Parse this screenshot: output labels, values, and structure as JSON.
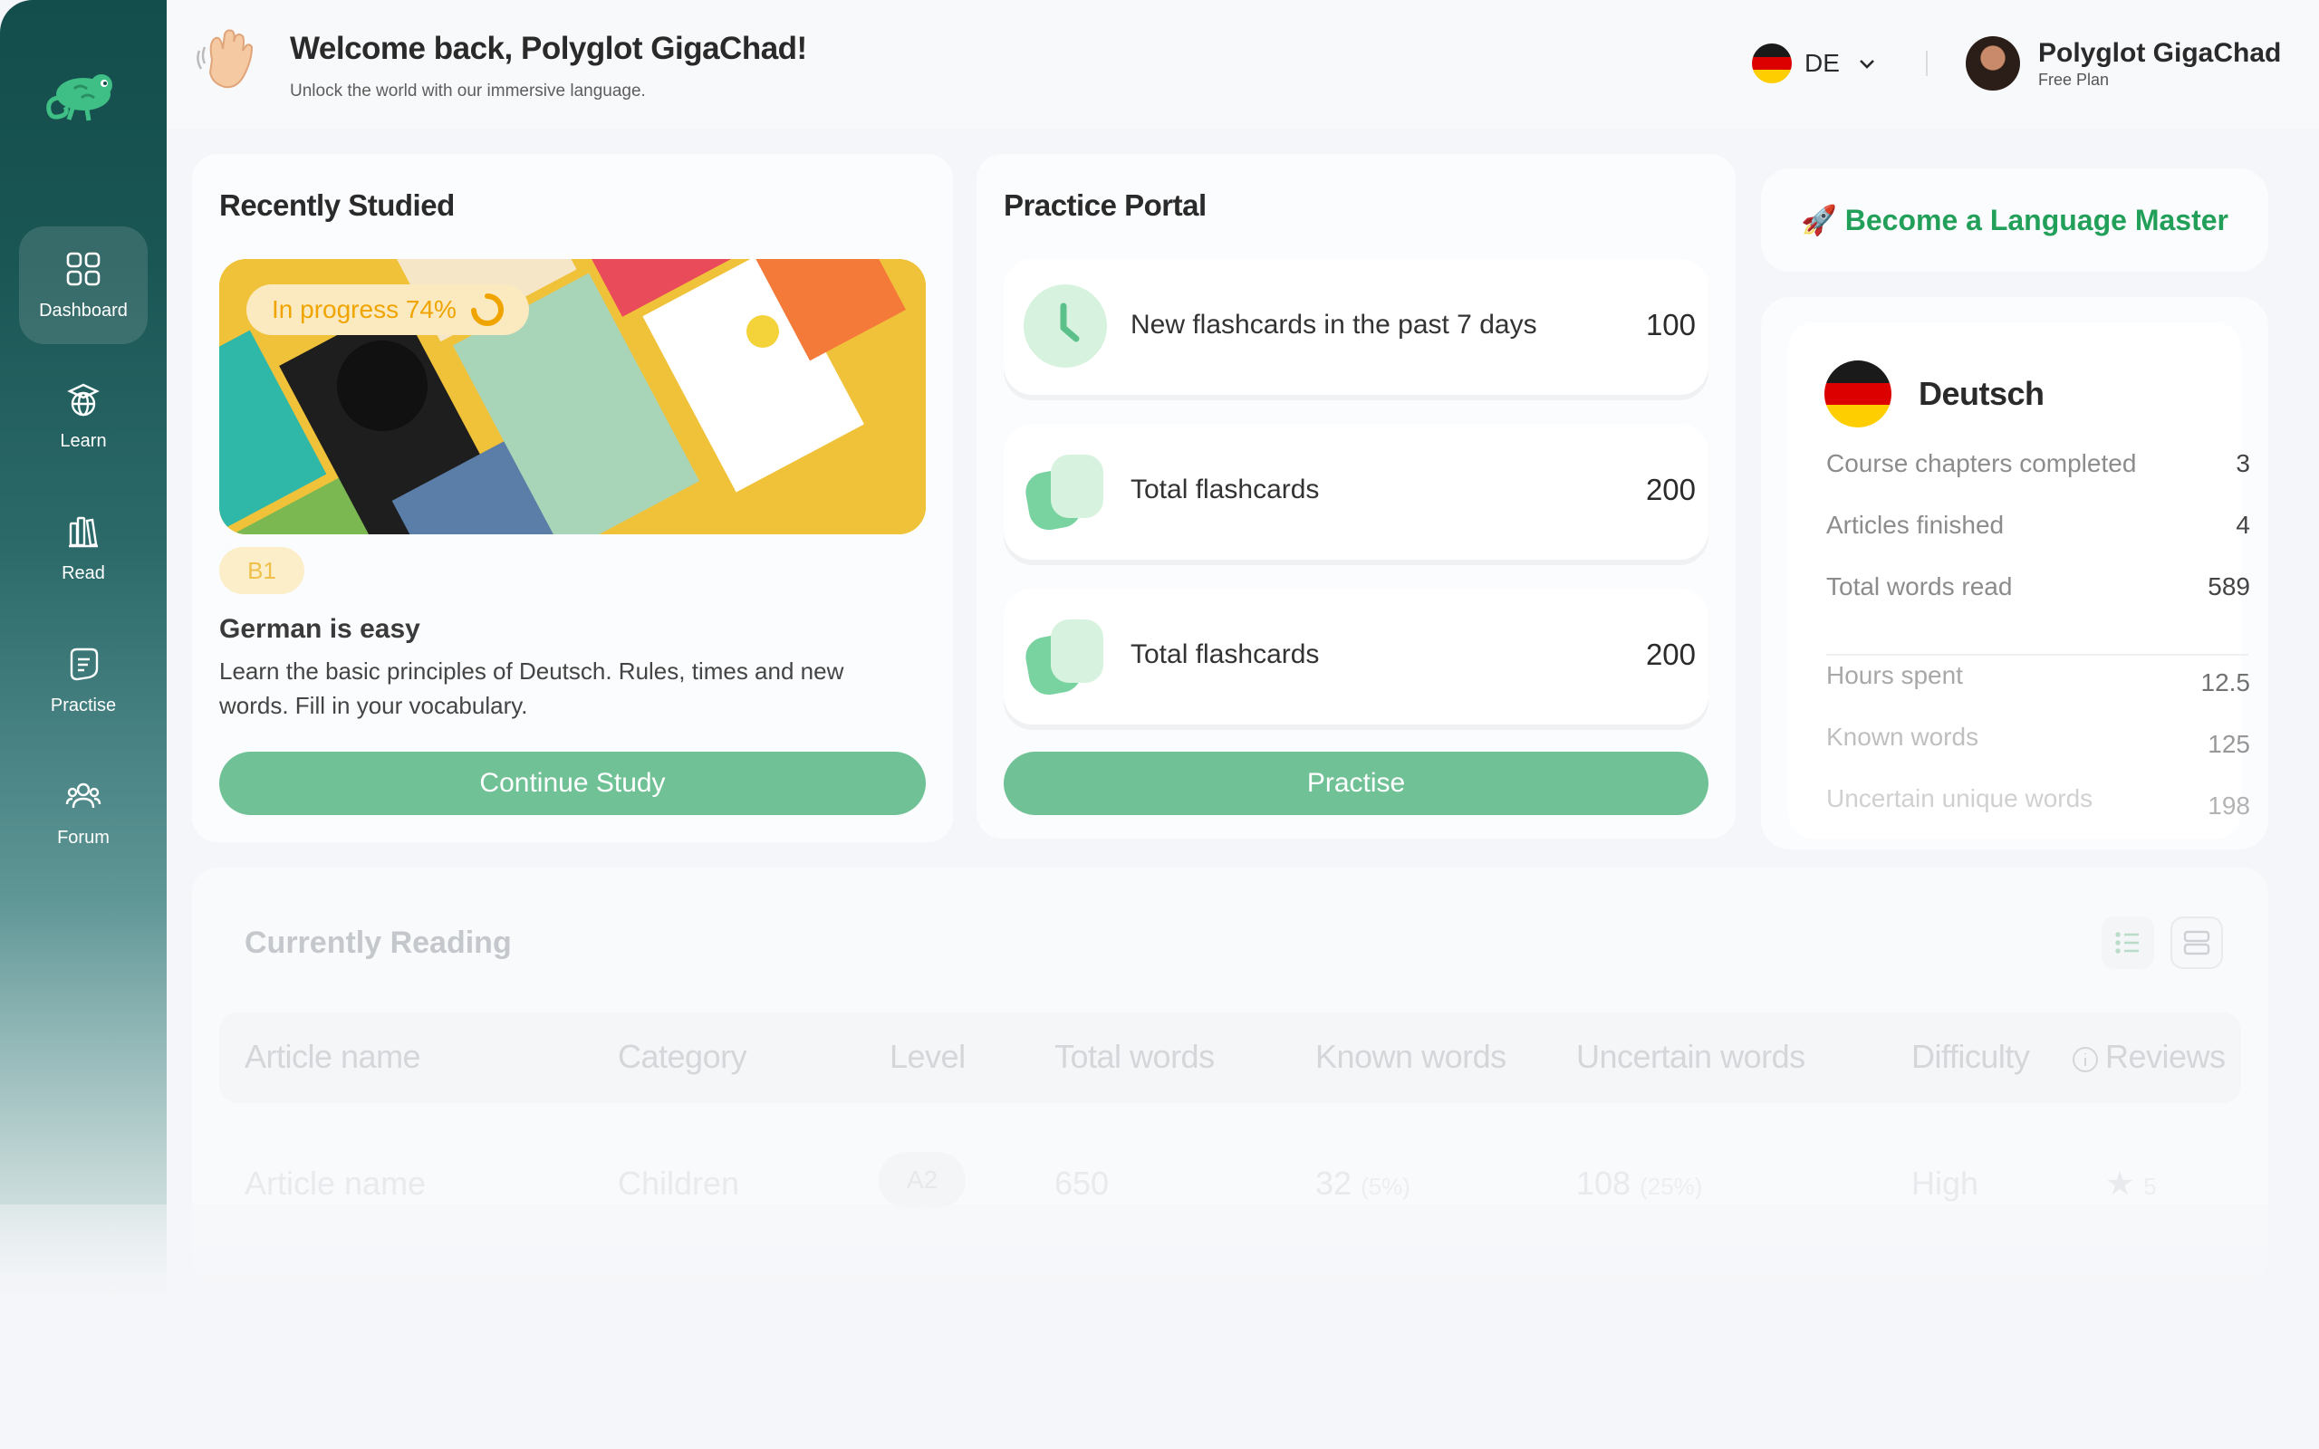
{
  "sidebar": {
    "items": [
      {
        "label": "Dashboard",
        "icon": "grid-icon"
      },
      {
        "label": "Learn",
        "icon": "globe-graduation-icon"
      },
      {
        "label": "Read",
        "icon": "books-icon"
      },
      {
        "label": "Practise",
        "icon": "flashcard-icon"
      },
      {
        "label": "Forum",
        "icon": "people-icon"
      }
    ]
  },
  "header": {
    "title": "Welcome back, Polyglot GigaChad!",
    "subtitle": "Unlock the world with our immersive language.",
    "language_code": "DE",
    "user_name": "Polyglot GigaChad",
    "user_plan": "Free Plan"
  },
  "recently_studied": {
    "title": "Recently Studied",
    "progress_label": "In progress 74%",
    "progress": 0.74,
    "level": "B1",
    "course_title": "German is easy",
    "course_description": "Learn the basic principles of Deutsch. Rules, times and new words. Fill in your vocabulary.",
    "button": "Continue Study"
  },
  "practice_portal": {
    "title": "Practice Portal",
    "rows": [
      {
        "label": "New flashcards in the past 7 days",
        "value": "100",
        "icon": "clock-icon"
      },
      {
        "label": "Total flashcards",
        "value": "200",
        "icon": "cards-icon"
      },
      {
        "label": "Total flashcards",
        "value": "200",
        "icon": "cards-icon"
      }
    ],
    "button": "Practise"
  },
  "master": {
    "label": "🚀 Become a Language Master"
  },
  "stats": {
    "language": "Deutsch",
    "rows": [
      {
        "label": "Course chapters completed",
        "value": "3"
      },
      {
        "label": "Articles finished",
        "value": "4"
      },
      {
        "label": "Total words read",
        "value": "589"
      },
      {
        "label": "Hours spent",
        "value": "12.5"
      },
      {
        "label": "Known words",
        "value": "125"
      },
      {
        "label": "Uncertain unique words",
        "value": "198"
      }
    ]
  },
  "currently_reading": {
    "title": "Currently Reading",
    "columns": [
      "Article name",
      "Category",
      "Level",
      "Total words",
      "Known words",
      "Uncertain words",
      "Difficulty",
      "Reviews"
    ],
    "rows": [
      {
        "article": "Article name",
        "category": "Children",
        "level": "A2",
        "total_words": "650",
        "known_words": "32",
        "known_pct": "(5%)",
        "uncertain_words": "108",
        "uncertain_pct": "(25%)",
        "difficulty": "High",
        "reviews": "5"
      }
    ]
  },
  "colors": {
    "sidebar": "#134d4c",
    "accent_green": "#70c296",
    "progress_orange": "#f0a400",
    "master_green": "#22a05a"
  }
}
